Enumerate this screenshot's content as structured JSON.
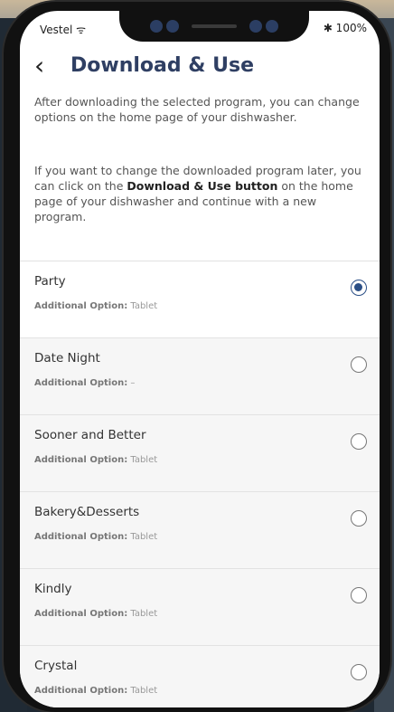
{
  "status": {
    "carrier": "Vestel ᯤ",
    "battery": "✱ 100%"
  },
  "header": {
    "back": "‹",
    "title": "Download & Use"
  },
  "intro": {
    "p1": "After downloading the selected program, you can change options on the home page of your dishwasher.",
    "p2_before": "If you want to change the downloaded program later, you can click on the ",
    "p2_bold": "Download & Use button",
    "p2_after": " on the home page of your dishwasher and continue with a new program."
  },
  "programs": [
    {
      "name": "Party",
      "option_label": "Additional Option:",
      "option_value": " Tablet",
      "selected": true
    },
    {
      "name": "Date Night",
      "option_label": "Additional Option:",
      "option_value": " –",
      "selected": false
    },
    {
      "name": "Sooner and Better",
      "option_label": "Additional Option:",
      "option_value": " Tablet",
      "selected": false
    },
    {
      "name": "Bakery&Desserts",
      "option_label": "Additional Option:",
      "option_value": " Tablet",
      "selected": false
    },
    {
      "name": "Kindly",
      "option_label": "Additional Option:",
      "option_value": " Tablet",
      "selected": false
    },
    {
      "name": "Crystal",
      "option_label": "Additional Option:",
      "option_value": " Tablet",
      "selected": false
    }
  ],
  "colors": {
    "accent": "#2b4f86",
    "title": "#2f3f63"
  }
}
